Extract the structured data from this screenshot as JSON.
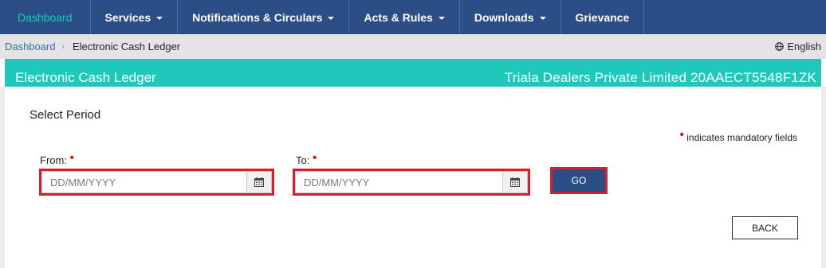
{
  "nav": {
    "items": [
      {
        "label": "Dashboard",
        "active": true,
        "dropdown": false
      },
      {
        "label": "Services",
        "active": false,
        "dropdown": true
      },
      {
        "label": "Notifications & Circulars",
        "active": false,
        "dropdown": true
      },
      {
        "label": "Acts & Rules",
        "active": false,
        "dropdown": true
      },
      {
        "label": "Downloads",
        "active": false,
        "dropdown": true
      },
      {
        "label": "Grievance",
        "active": false,
        "dropdown": false
      }
    ]
  },
  "breadcrumb": {
    "home": "Dashboard",
    "separator": "›",
    "current": "Electronic Cash Ledger",
    "language": "English",
    "language_icon": "globe-icon"
  },
  "header": {
    "title": "Electronic Cash Ledger",
    "company": "Triala Dealers Private Limited 20AAECT5548F1ZK"
  },
  "form": {
    "section_title": "Select Period",
    "mandatory_note": "indicates mandatory fields",
    "required_marker": "•",
    "from": {
      "label": "From:",
      "value": "",
      "placeholder": "DD/MM/YYYY",
      "icon": "calendar-icon"
    },
    "to": {
      "label": "To:",
      "value": "",
      "placeholder": "DD/MM/YYYY",
      "icon": "calendar-icon"
    },
    "go_label": "GO",
    "back_label": "BACK"
  },
  "colors": {
    "nav_bg": "#2c4e86",
    "nav_active": "#1fc8bb",
    "header_bg": "#1fc8bb",
    "highlight_border": "#d61f2c",
    "required": "#e01010"
  }
}
